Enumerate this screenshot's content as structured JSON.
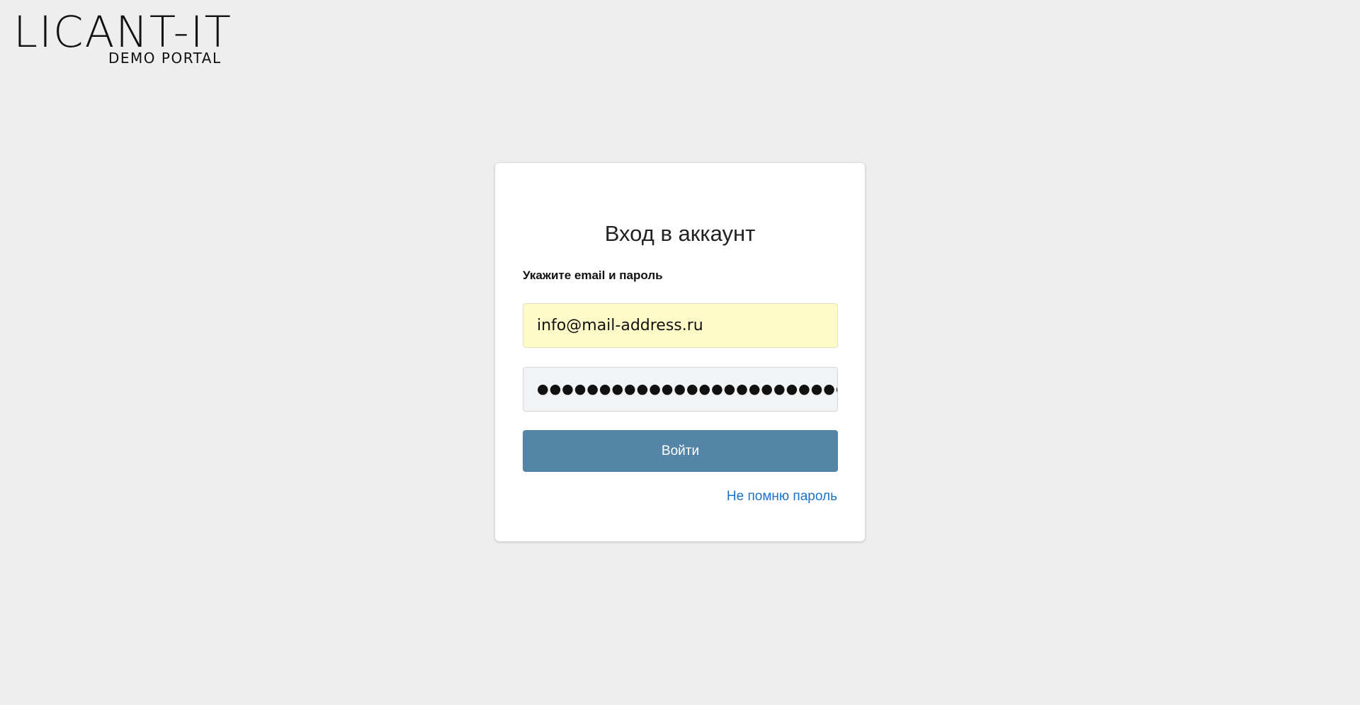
{
  "logo": {
    "main": "LICANT-IT",
    "sub": "DEMO PORTAL"
  },
  "login_card": {
    "title": "Вход в аккаунт",
    "subtitle": "Укажите email и пароль",
    "email_value": "info@mail-address.ru",
    "password_masked": "●●●●●●●●●●●●●●●●●●●●●●●●●",
    "submit_label": "Войти",
    "forgot_label": "Не помню пароль"
  },
  "colors": {
    "background": "#eeeeee",
    "button": "#5585a6",
    "link": "#1a73c8",
    "autofill": "#fefbc9"
  }
}
